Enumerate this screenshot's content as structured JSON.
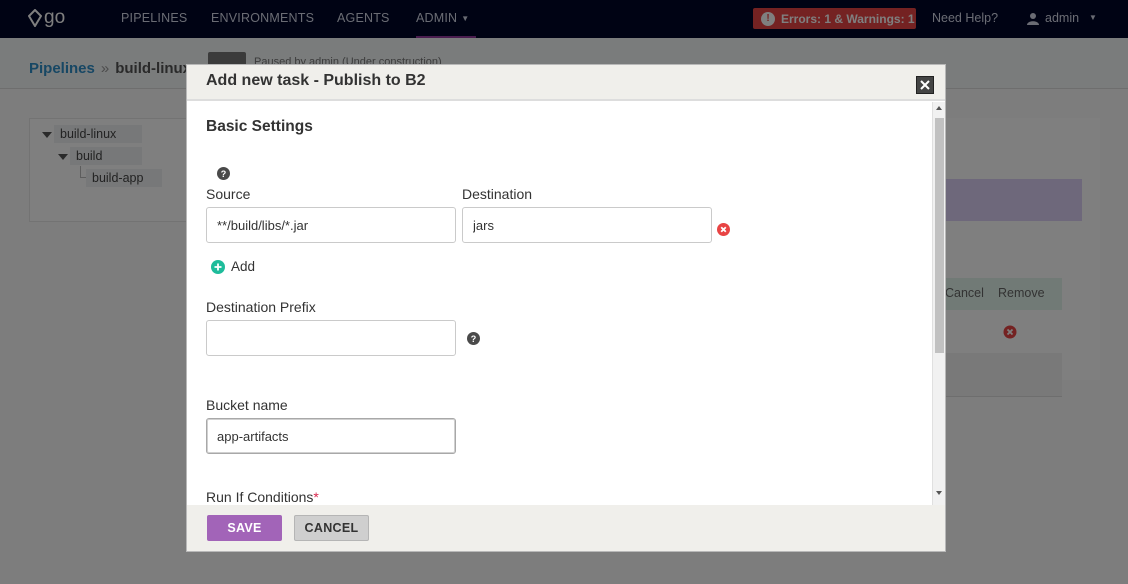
{
  "nav": {
    "logo": "go",
    "items": [
      {
        "label": "PIPELINES"
      },
      {
        "label": "ENVIRONMENTS"
      },
      {
        "label": "AGENTS"
      },
      {
        "label": "ADMIN"
      }
    ],
    "errors_badge": "Errors: 1 & Warnings: 1",
    "help": "Need Help?",
    "user": "admin"
  },
  "breadcrumb": {
    "root": "Pipelines",
    "sep": "»",
    "current": "build-linux"
  },
  "status_text": "Paused by admin   (Under construction)",
  "tree": {
    "pipeline": "build-linux",
    "stage": "build",
    "job": "build-app"
  },
  "table": {
    "col_cancel": "Cancel",
    "col_remove": "Remove"
  },
  "modal": {
    "title": "Add new task - Publish to B2",
    "section": "Basic Settings",
    "source_label": "Source",
    "source_value": "**/build/libs/*.jar",
    "destination_label": "Destination",
    "destination_value": "jars",
    "add_label": "Add",
    "prefix_label": "Destination Prefix",
    "prefix_value": "",
    "bucket_label": "Bucket name",
    "bucket_value": "app-artifacts",
    "run_if_label": "Run If Conditions",
    "required_mark": "*",
    "save_label": "SAVE",
    "cancel_label": "CANCEL"
  },
  "colors": {
    "nav_bg": "#000728",
    "accent_purple": "#a264b8",
    "error_red": "#e84444",
    "link_blue": "#2f8fc9",
    "add_green": "#1ebc9b"
  }
}
